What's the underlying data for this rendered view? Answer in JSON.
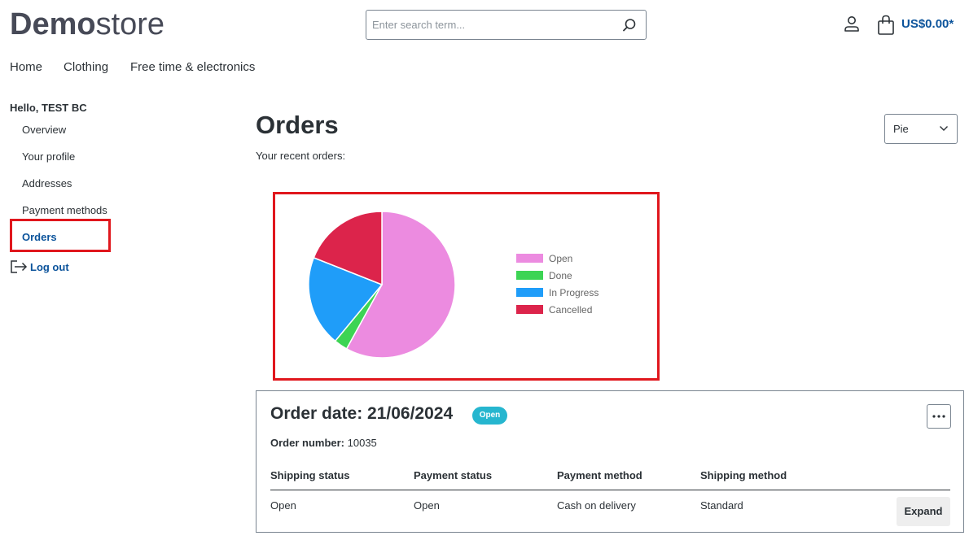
{
  "header": {
    "logo_bold": "Demo",
    "logo_light": "store",
    "search_placeholder": "Enter search term...",
    "cart_total": "US$0.00*"
  },
  "nav": {
    "items": [
      "Home",
      "Clothing",
      "Free time & electronics"
    ]
  },
  "sidebar": {
    "greeting": "Hello, TEST BC",
    "items": [
      "Overview",
      "Your profile",
      "Addresses",
      "Payment methods",
      "Orders"
    ],
    "active": "Orders",
    "logout": "Log out"
  },
  "main": {
    "title": "Orders",
    "subtitle": "Your recent orders:",
    "chart_type_select": "Pie"
  },
  "chart_data": {
    "type": "pie",
    "labels": [
      "Open",
      "Done",
      "In Progress",
      "Cancelled"
    ],
    "values": [
      58,
      3,
      20,
      19
    ],
    "colors": [
      "#ec8be0",
      "#3dd454",
      "#1f9df9",
      "#dc244b"
    ],
    "legend_position": "right"
  },
  "order": {
    "date_label": "Order date: 21/06/2024",
    "status_badge": "Open",
    "number_label": "Order number:",
    "number_value": "10035",
    "columns": [
      {
        "head": "Shipping status",
        "value": "Open"
      },
      {
        "head": "Payment status",
        "value": "Open"
      },
      {
        "head": "Payment method",
        "value": "Cash on delivery"
      },
      {
        "head": "Shipping method",
        "value": "Standard"
      }
    ],
    "expand_label": "Expand"
  },
  "colors": {
    "accent": "#0b539b",
    "highlight": "#e0171d",
    "badge": "#26b6cf"
  }
}
